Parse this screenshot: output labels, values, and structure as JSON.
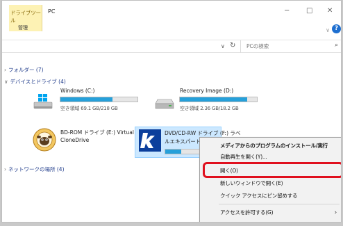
{
  "ribbon": {
    "tool_tab": "ドライブツール",
    "manage": "管理",
    "window_title": "PC",
    "minimize": "−",
    "maximize": "□",
    "close": "✕",
    "help": "?"
  },
  "address": {
    "search_placeholder": "PCの検索"
  },
  "groups": {
    "folders": "フォルダー (7)",
    "devices": "デバイスとドライブ (4)",
    "network": "ネットワークの場所 (4)"
  },
  "drives": [
    {
      "name": "Windows (C:)",
      "space": "空き領域 69.1 GB/218 GB",
      "used_fraction": 0.68,
      "icon": "windows-drive-icon"
    },
    {
      "name": "Recovery Image (D:)",
      "space": "空き領域 2.36 GB/18.2 GB",
      "used_fraction": 0.87,
      "icon": "hard-drive-icon"
    },
    {
      "name_line1": "BD-ROM ドライブ (E:) Virtual",
      "name_line2": "CloneDrive",
      "icon": "clonedrive-sheep-icon"
    },
    {
      "name_line1": "DVD/CD-RW ドライブ (F:) ラベ",
      "name_line2": "ルエキスパート",
      "icon": "disc-label-icon"
    }
  ],
  "context_menu": {
    "items": [
      "メディアからのプログラムのインストール/実行",
      "自動再生を開く(Y)...",
      "開く(O)",
      "新しいウィンドウで開く(E)",
      "クイック アクセスにピン留めする",
      "アクセスを許可する(G)"
    ],
    "submenu_arrow": "›"
  },
  "colors": {
    "accent": "#26a0da",
    "highlight": "#e0101e",
    "tool_tab_bg": "#fdf2b4"
  }
}
